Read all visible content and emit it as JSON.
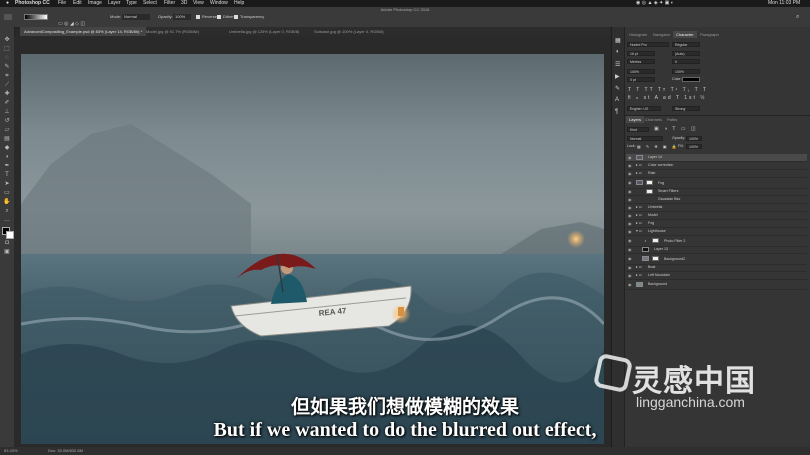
{
  "menubar": {
    "app": "Photoshop CC",
    "items": [
      "File",
      "Edit",
      "Image",
      "Layer",
      "Type",
      "Select",
      "Filter",
      "3D",
      "View",
      "Window",
      "Help"
    ],
    "clock": "Mon 11:03 PM"
  },
  "window_title": "Adobe Photoshop CC 2018",
  "options": {
    "mode_label": "Mode:",
    "mode_value": "Normal",
    "opacity_label": "Opacity:",
    "opacity_value": "100%",
    "reverse": "Reverse",
    "dither": "Dither",
    "transparency": "Transparency"
  },
  "doc_tabs": [
    {
      "label": "AdvancedCompositing_Example.psd @ 83% (Layer 14, RGB/8#) *",
      "active": true
    },
    {
      "label": "Model.jpg @ 91.7% (RGB/8#)",
      "active": false
    },
    {
      "label": "Umbrella.jpg @ 125% (Layer 0, RGB/8)",
      "active": false
    },
    {
      "label": "Suitcase.jpg @ 100% (Layer 0, RGB/8)",
      "active": false
    }
  ],
  "panels": {
    "top_tabs": [
      "Histogram",
      "Navigator",
      "Character",
      "Paragraph"
    ],
    "active_top_tab": "Character",
    "character": {
      "font": "Hurled Pro",
      "style": "Regular",
      "size": "16 pt",
      "leading": "(Auto)",
      "kerning": "Metrics",
      "tracking": "0",
      "vscale": "100%",
      "hscale": "100%",
      "baseline": "0 pt",
      "color_label": "Color:",
      "language": "English: US",
      "aa": "Strong"
    },
    "layer_tabs": [
      "Layers",
      "Channels",
      "Paths"
    ],
    "active_layer_tab": "Layers",
    "kind": "Kind",
    "blend_mode": "Normal",
    "opacity_label": "Opacity:",
    "opacity": "100%",
    "lock_label": "Lock:",
    "fill_label": "Fill:",
    "fill": "100%",
    "layers": [
      {
        "name": "Layer 14",
        "selected": true
      },
      {
        "name": "Color correction"
      },
      {
        "name": "Rain"
      },
      {
        "name": "Fog"
      },
      {
        "name": "Smart Filters"
      },
      {
        "name": "Gaussian Blur"
      },
      {
        "name": "Umbrella"
      },
      {
        "name": "Model"
      },
      {
        "name": "Fog"
      },
      {
        "name": "Lighthouse"
      },
      {
        "name": "Photo Filter 2"
      },
      {
        "name": "Layer 13"
      },
      {
        "name": "Background2"
      },
      {
        "name": "Boat"
      },
      {
        "name": "Left Mountain"
      },
      {
        "name": "Background"
      }
    ]
  },
  "status": {
    "zoom": "83.33%",
    "doc": "Doc: 33.0M/832.8M"
  },
  "scene": {
    "boat_text": "REA 47"
  },
  "subtitles": {
    "cn": "但如果我们想做模糊的效果",
    "en": "But if we wanted to do the blurred out effect,"
  },
  "watermark": {
    "cn": "灵感中国",
    "url": "lingganchina.com"
  }
}
